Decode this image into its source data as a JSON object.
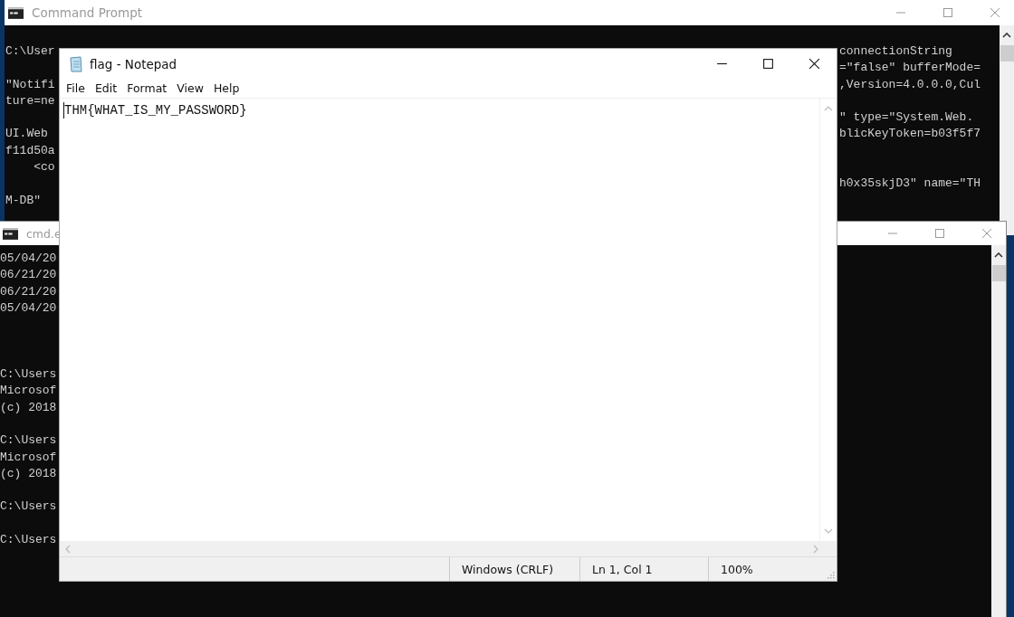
{
  "command_prompt": {
    "title": "Command Prompt",
    "lines": [
      {
        "left": "C:\\User",
        "right": "connectionString"
      },
      {
        "right": "=\"false\" bufferMode="
      },
      {
        "left": "\"Notifi",
        "right": ",Version=4.0.0.0,Cul"
      },
      {
        "left": "ture=ne"
      },
      {
        "right": "\" type=\"System.Web."
      },
      {
        "left": "UI.Web",
        "right": "blicKeyToken=b03f5f7"
      },
      {
        "left": "f11d50a"
      },
      {
        "left": "    <co"
      },
      {
        "right": "h0x35skjD3\" name=\"TH"
      },
      {
        "left": "M-DB\""
      }
    ]
  },
  "cmd_window": {
    "title": "cmd.e",
    "blocks": [
      [
        "05/04/20",
        "06/21/20",
        "06/21/20",
        "05/04/20"
      ],
      [
        "C:\\Users",
        "Microsof",
        "(c) 2018"
      ],
      [
        "C:\\Users",
        "Microsof",
        "(c) 2018"
      ],
      [
        "C:\\Users"
      ],
      [
        "C:\\Users"
      ]
    ]
  },
  "notepad": {
    "title": "flag - Notepad",
    "menu": [
      "File",
      "Edit",
      "Format",
      "View",
      "Help"
    ],
    "content": "THM{WHAT_IS_MY_PASSWORD}",
    "status": {
      "line_ending": "Windows (CRLF)",
      "position": "Ln 1, Col 1",
      "zoom": "100%"
    }
  }
}
